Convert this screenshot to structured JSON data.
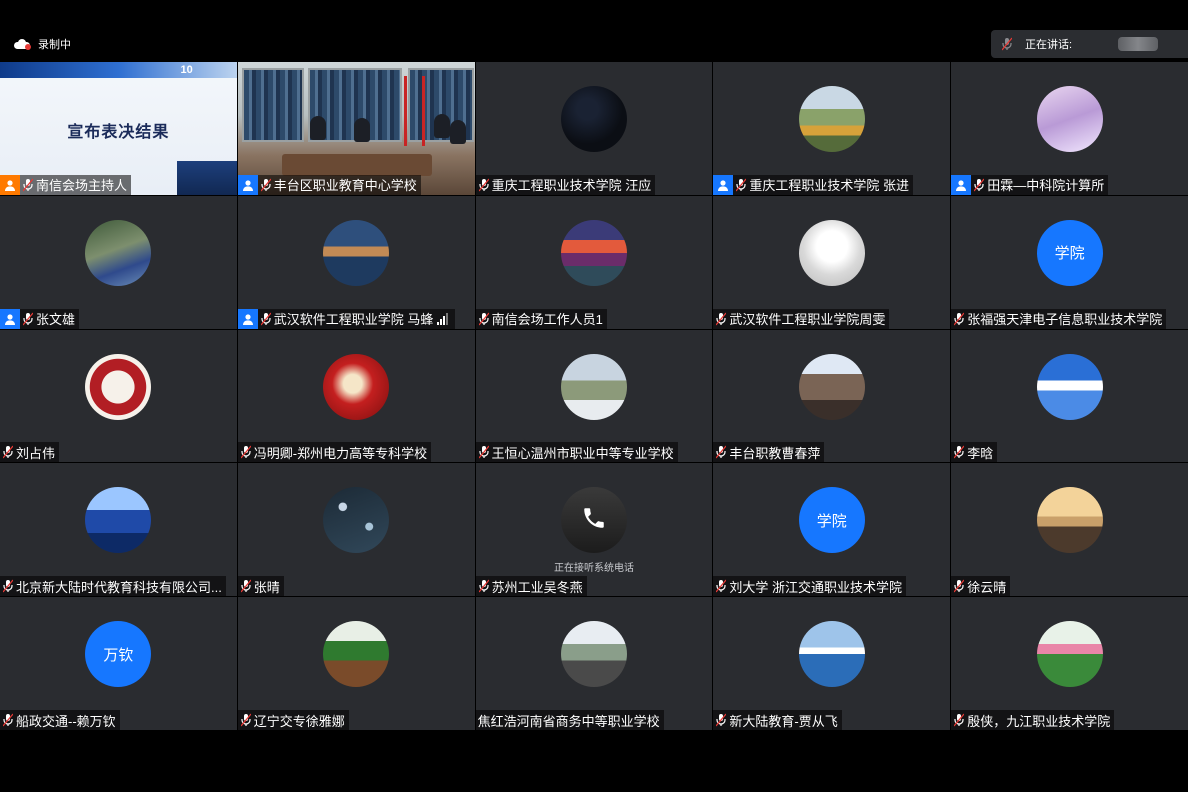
{
  "recording": {
    "label": "录制中"
  },
  "speaking": {
    "label": "正在讲话:"
  },
  "slide": {
    "title": "宣布表决结果",
    "logo": "10"
  },
  "tiles": [
    {
      "name": "南信会场主持人",
      "role": "host"
    },
    {
      "name": "丰台区职业教育中心学校",
      "role": "member"
    },
    {
      "name": "重庆工程职业技术学院 汪应"
    },
    {
      "name": "重庆工程职业技术学院 张进",
      "role": "member"
    },
    {
      "name": "田霖—中科院计算所",
      "role": "member"
    },
    {
      "name": "张文雄",
      "role": "member"
    },
    {
      "name": "武汉软件工程职业学院 马蜂",
      "role": "member",
      "signal": true
    },
    {
      "name": "南信会场工作人员1"
    },
    {
      "name": "武汉软件工程职业学院周雯"
    },
    {
      "name": "张福强天津电子信息职业技术学院",
      "avatar_text": "学院"
    },
    {
      "name": "刘占伟"
    },
    {
      "name": "冯明卿-郑州电力高等专科学校"
    },
    {
      "name": "王恒心温州市职业中等专业学校"
    },
    {
      "name": "丰台职教曹春萍"
    },
    {
      "name": "李晗"
    },
    {
      "name": "北京新大陆时代教育科技有限公司..."
    },
    {
      "name": "张晴"
    },
    {
      "name": "苏州工业吴冬燕",
      "phone_message": "正在接听系统电话"
    },
    {
      "name": "刘大学 浙江交通职业技术学院",
      "avatar_text": "学院"
    },
    {
      "name": "徐云晴"
    },
    {
      "name": "船政交通--赖万钦",
      "avatar_text": "万钦"
    },
    {
      "name": "辽宁交专徐雅娜"
    },
    {
      "name": "焦红浩河南省商务中等职业学校",
      "no_mic": true
    },
    {
      "name": "新大陆教育-贾从飞"
    },
    {
      "name": "殷侠，九江职业技术学院"
    }
  ]
}
